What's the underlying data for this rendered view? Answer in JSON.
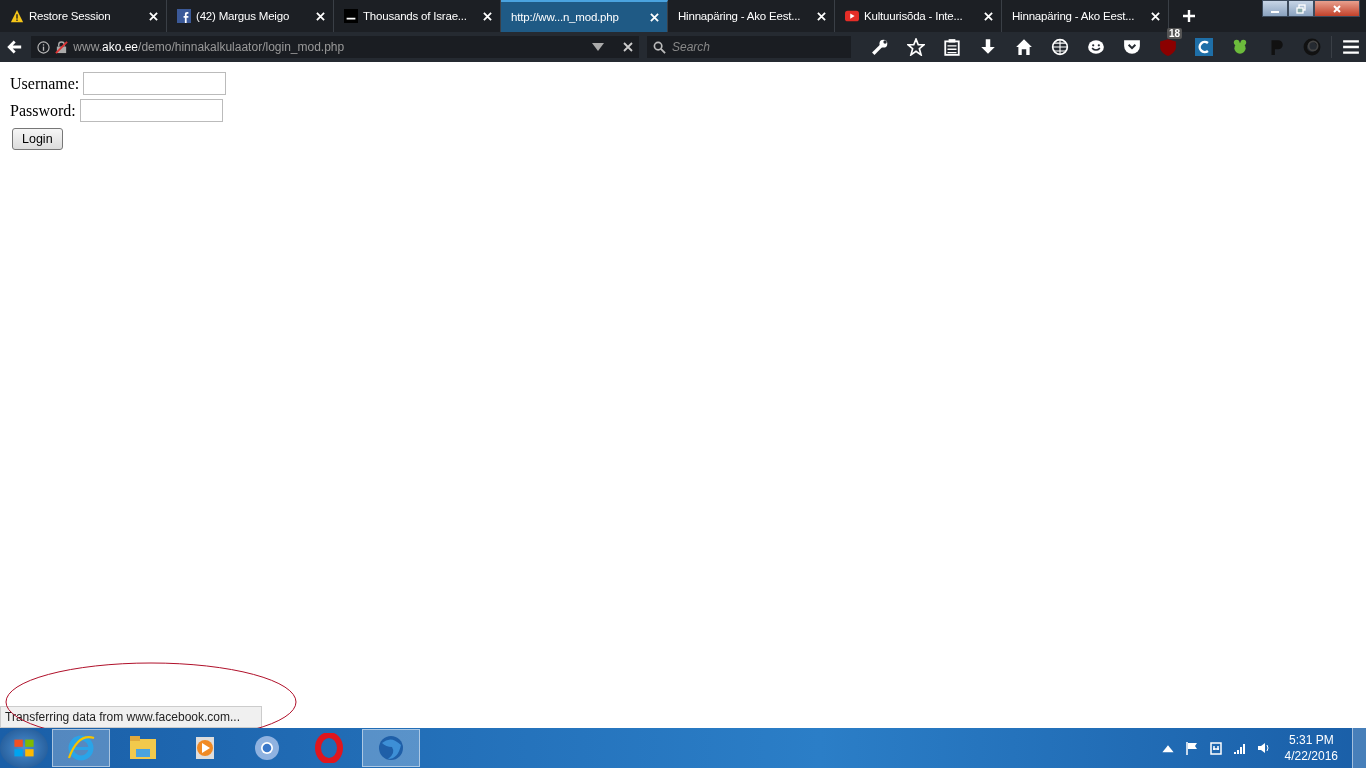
{
  "tabs": [
    {
      "label": "Restore Session",
      "kind": "warning",
      "selected": false
    },
    {
      "label": "(42) Margus Meigo",
      "kind": "facebook",
      "selected": false
    },
    {
      "label": "Thousands of Israe...",
      "kind": "square",
      "selected": false
    },
    {
      "label": "http://ww...n_mod.php",
      "kind": "none",
      "selected": true
    },
    {
      "label": "Hinnapäring - Ako Eest...",
      "kind": "none",
      "selected": false
    },
    {
      "label": "Kultuurisõda - Inte...",
      "kind": "youtube",
      "selected": false
    },
    {
      "label": "Hinnapäring - Ako Eest...",
      "kind": "none",
      "selected": false
    }
  ],
  "address": {
    "prefix": "www.",
    "host": "ako.ee",
    "path": "/demo/hinnakalkulaator/login_mod.php"
  },
  "search": {
    "placeholder": "Search"
  },
  "toolbar": {
    "badge": "18"
  },
  "form": {
    "fields": [
      {
        "label": "Username:"
      },
      {
        "label": "Password:"
      }
    ],
    "button": "Login"
  },
  "status": "Transferring data from www.facebook.com...",
  "taskbar": {
    "apps": [
      {
        "kind": "ie",
        "running": true
      },
      {
        "kind": "explorer",
        "running": false
      },
      {
        "kind": "media",
        "running": false
      },
      {
        "kind": "chrome",
        "running": false
      },
      {
        "kind": "opera",
        "running": false
      },
      {
        "kind": "firefox",
        "running": true
      }
    ],
    "time": "5:31 PM",
    "date": "4/22/2016"
  }
}
